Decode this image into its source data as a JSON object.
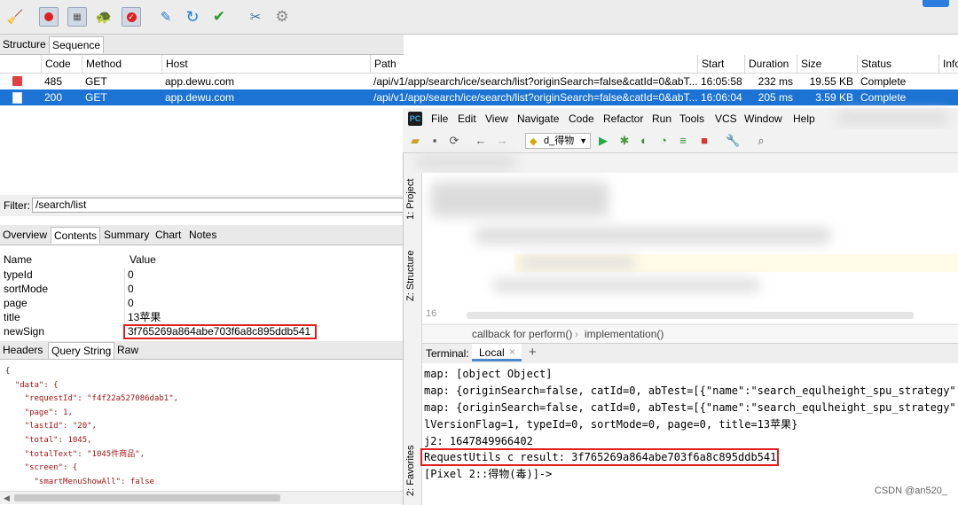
{
  "toolbar": {
    "icons": [
      "broom-icon",
      "record-icon",
      "throttle-icon",
      "turtle-icon",
      "breakpoint-icon",
      "pen-icon",
      "refresh-icon",
      "check-icon",
      "tools-icon",
      "settings-icon"
    ]
  },
  "view_tabs": [
    "Structure",
    "Sequence"
  ],
  "sequence": {
    "columns": [
      "Code",
      "Method",
      "Host",
      "Path",
      "Start",
      "Duration",
      "Size",
      "Status",
      "Info"
    ],
    "rows": [
      {
        "code": "485",
        "method": "GET",
        "host": "app.dewu.com",
        "path": "/api/v1/app/search/ice/search/list?originSearch=false&catId=0&abT...",
        "start": "16:05:58",
        "duration": "232 ms",
        "size": "19.55 KB",
        "status": "Complete"
      },
      {
        "code": "200",
        "method": "GET",
        "host": "app.dewu.com",
        "path": "/api/v1/app/search/ice/search/list?originSearch=false&catId=0&abT...",
        "start": "16:06:04",
        "duration": "205 ms",
        "size": "3.59 KB",
        "status": "Complete"
      }
    ]
  },
  "filter": {
    "label": "Filter:",
    "value": "/search/list"
  },
  "detail_tabs": [
    "Overview",
    "Contents",
    "Summary",
    "Chart",
    "Notes"
  ],
  "query_table": {
    "headers": [
      "Name",
      "Value"
    ],
    "rows": [
      {
        "name": "typeId",
        "value": "0"
      },
      {
        "name": "sortMode",
        "value": "0"
      },
      {
        "name": "page",
        "value": "0"
      },
      {
        "name": "title",
        "value": "13苹果"
      },
      {
        "name": "newSign",
        "value": "3f765269a864abe703f6a8c895ddb541"
      }
    ]
  },
  "request_tabs": [
    "Headers",
    "Query String",
    "Raw"
  ],
  "json_lines": [
    "{",
    "  \"data\": {",
    "    \"requestId\": \"f4f22a527086dab1\",",
    "    \"page\": 1,",
    "    \"lastId\": \"20\",",
    "    \"total\": 1045,",
    "    \"totalText\": \"1045件商品\",",
    "    \"screen\": {",
    "      \"smartMenuShowAll\": false"
  ],
  "ide": {
    "menu": [
      "File",
      "Edit",
      "View",
      "Navigate",
      "Code",
      "Refactor",
      "Run",
      "Tools",
      "VCS",
      "Window",
      "Help"
    ],
    "run_config": "d_得物",
    "side_labels": [
      "1: Project",
      "Z: Structure",
      "2: Favorites"
    ],
    "line_number": "16",
    "breadcrumb": [
      "callback for perform()",
      "implementation()"
    ],
    "terminal_label": "Terminal:",
    "terminal_tab": "Local",
    "terminal_lines": [
      "map: [object Object]",
      "map: {originSearch=false, catId=0, abTest=[{\"name\":\"search_equlheight_spu_strategy\",",
      "map: {originSearch=false, catId=0, abTest=[{\"name\":\"search_equlheight_spu_strategy\",",
      "lVersionFlag=1, typeId=0, sortMode=0, page=0, title=13苹果}",
      "j2: 1647849966402",
      "RequestUtils c result: 3f765269a864abe703f6a8c895ddb541",
      "[Pixel 2::得物(毒)]->"
    ]
  },
  "watermark": "CSDN @an520_"
}
